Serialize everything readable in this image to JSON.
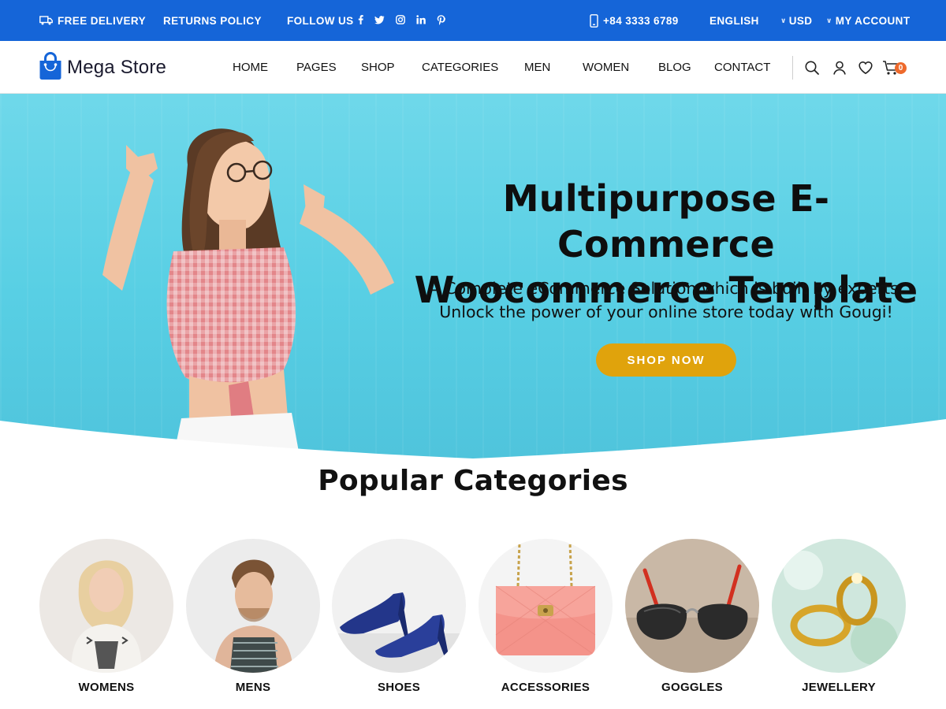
{
  "topbar": {
    "delivery": "FREE DELIVERY",
    "returns": "RETURNS POLICY",
    "follow": "FOLLOW US",
    "social": [
      "f",
      "t",
      "ig",
      "in",
      "p"
    ],
    "phone": "+84 3333 6789",
    "language": "ENGLISH",
    "currency": "USD",
    "account": "MY ACCOUNT"
  },
  "header": {
    "logo_text": "Mega Store",
    "nav": [
      "HOME",
      "PAGES",
      "SHOP",
      "CATEGORIES",
      "MEN",
      "WOMEN",
      "BLOG",
      "CONTACT"
    ],
    "cart_count": "0"
  },
  "hero": {
    "title_line1": "Multipurpose E-Commerce",
    "title_line2": "Woocommerce Template",
    "subtitle_line1": "A Complete eCommerce Solution which is built by experts.",
    "subtitle_line2": "Unlock the power of your online store today with Gougi!",
    "button": "SHOP NOW"
  },
  "categories": {
    "title": "Popular Categories",
    "items": [
      "WOMENS",
      "MENS",
      "SHOES",
      "ACCESSORIES",
      "GOGGLES",
      "JEWELLERY"
    ]
  },
  "colors": {
    "topbar": "#1565d8",
    "accent": "#e0a30c",
    "badge": "#ee6a2c",
    "hero_bg": "#58cfe4"
  },
  "icons": [
    "truck-icon",
    "facebook-icon",
    "twitter-icon",
    "instagram-icon",
    "linkedin-icon",
    "pinterest-icon",
    "phone-icon",
    "bag-logo-icon",
    "search-icon",
    "user-icon",
    "heart-icon",
    "cart-icon"
  ]
}
